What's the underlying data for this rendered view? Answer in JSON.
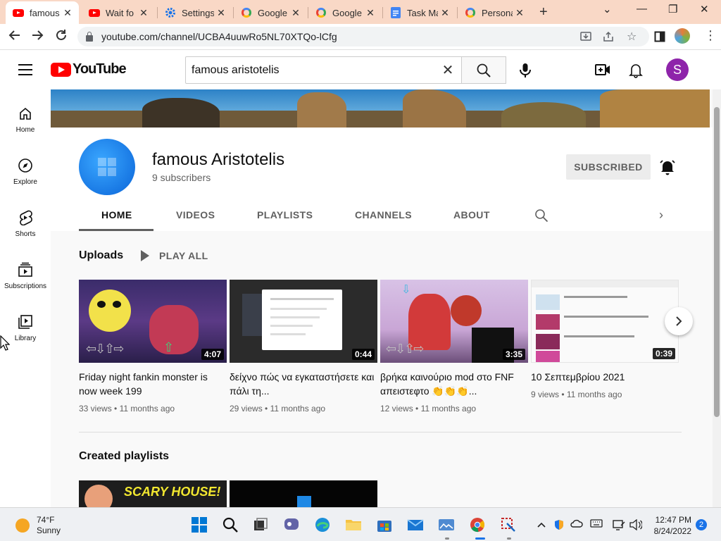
{
  "browser": {
    "tabs": [
      {
        "title": "famous",
        "favicon": "youtube-icon",
        "active": true
      },
      {
        "title": "Wait fo",
        "favicon": "youtube-icon",
        "active": false
      },
      {
        "title": "Settings",
        "favicon": "gear-icon",
        "active": false
      },
      {
        "title": "Google",
        "favicon": "google-icon",
        "active": false
      },
      {
        "title": "Google",
        "favicon": "google-icon",
        "active": false
      },
      {
        "title": "Task Ma",
        "favicon": "docs-icon",
        "active": false
      },
      {
        "title": "Persona",
        "favicon": "google-icon",
        "active": false
      }
    ],
    "new_tab": "+",
    "url": "youtube.com/channel/UCBA4uuwRo5NL70XTQo-lCfg"
  },
  "youtube": {
    "logo_text": "YouTube",
    "search_value": "famous aristotelis",
    "avatar_letter": "S",
    "guide": [
      {
        "label": "Home",
        "icon": "home-icon"
      },
      {
        "label": "Explore",
        "icon": "compass-icon"
      },
      {
        "label": "Shorts",
        "icon": "shorts-icon"
      },
      {
        "label": "Subscriptions",
        "icon": "subscriptions-icon"
      },
      {
        "label": "Library",
        "icon": "library-icon"
      }
    ]
  },
  "channel": {
    "name": "famous Aristotelis",
    "subscribers": "9 subscribers",
    "subscribe_label": "SUBSCRIBED",
    "tabs": [
      "HOME",
      "VIDEOS",
      "PLAYLISTS",
      "CHANNELS",
      "ABOUT"
    ],
    "active_tab": "HOME"
  },
  "uploads": {
    "title": "Uploads",
    "play_all": "PLAY ALL",
    "videos": [
      {
        "title": "Friday night fankin monster is now week 199",
        "duration": "4:07",
        "views": "33 views",
        "age": "11 months ago"
      },
      {
        "title": "δείχνο πώς να εγκαταστήσετε και πάλι τη...",
        "duration": "0:44",
        "views": "29 views",
        "age": "11 months ago"
      },
      {
        "title": "βρήκα καινούριο mod στο FNF απειστεφτο 👏👏👏...",
        "duration": "3:35",
        "views": "12 views",
        "age": "11 months ago"
      },
      {
        "title": "10 Σεπτεμβρίου 2021",
        "duration": "0:39",
        "views": "9 views",
        "age": "11 months ago"
      }
    ]
  },
  "playlists": {
    "title": "Created playlists",
    "first_thumb_text": "SCARY HOUSE!"
  },
  "taskbar": {
    "temperature": "74°F",
    "condition": "Sunny",
    "time": "12:47 PM",
    "date": "8/24/2022",
    "notifications": "2"
  },
  "colors": {
    "tab_strip": "#f9d8c6",
    "youtube_red": "#ff0000",
    "avatar": "#8e24aa",
    "subscribed_bg": "#ececec"
  }
}
